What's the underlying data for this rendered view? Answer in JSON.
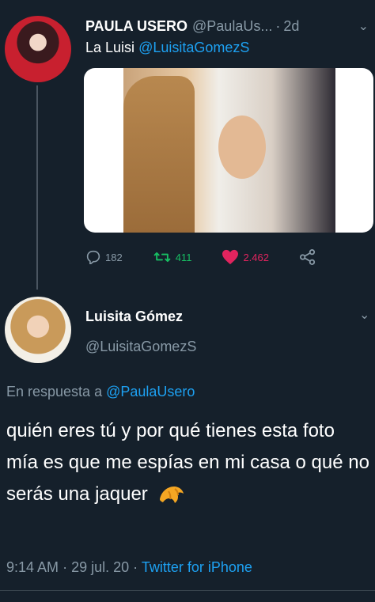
{
  "colors": {
    "background": "#15202b",
    "text": "#ffffff",
    "muted": "#8899a6",
    "link": "#1da1f2",
    "retweet": "#17bf63",
    "like": "#e0245e"
  },
  "tweet1": {
    "author_name": "PAULA USERO",
    "author_handle": "@PaulaUs...",
    "separator": "·",
    "time": "2d",
    "text_prefix": "La Luisi",
    "mention": "@LuisitaGomezS",
    "media_icon": "photo-mirror-selfie",
    "stats": {
      "replies": "182",
      "retweets": "411",
      "likes": "2.462"
    }
  },
  "tweet2": {
    "author_name": "Luisita Gómez",
    "author_handle": "@LuisitaGomezS",
    "reply_prefix": "En respuesta a",
    "reply_to": "@PaulaUsero",
    "text": "quién eres tú y por qué tienes esta foto mía es que me espías en mi casa o qué no serás una jaquer",
    "emoji": "croissant-icon",
    "meta": {
      "time": "9:14 AM",
      "separator": "·",
      "date": "29 jul. 20",
      "source": "Twitter for iPhone"
    }
  }
}
